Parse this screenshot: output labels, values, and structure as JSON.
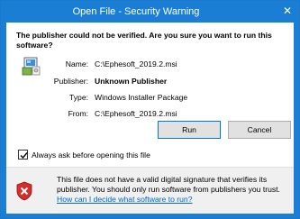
{
  "window": {
    "title": "Open File - Security Warning",
    "close_glyph": "✕"
  },
  "dialog": {
    "question": "The publisher could not be verified.  Are you sure you want to run this software?",
    "icon": "installer-file-icon",
    "details": [
      {
        "label": "Name:",
        "value": "C:\\Ephesoft_2019.2.msi",
        "bold": false
      },
      {
        "label": "Publisher:",
        "value": "Unknown Publisher",
        "bold": true
      },
      {
        "label": "Type:",
        "value": "Windows Installer Package",
        "bold": false
      },
      {
        "label": "From:",
        "value": "C:\\Ephesoft_2019.2.msi",
        "bold": false
      }
    ],
    "buttons": {
      "run": "Run",
      "cancel": "Cancel"
    },
    "checkbox": {
      "label": "Always ask before opening this file",
      "checked": true
    }
  },
  "info": {
    "icon": "shield-error-icon",
    "message": "This file does not have a valid digital signature that verifies its publisher.  You should only run software from publishers you trust.",
    "link": "How can I decide what software to run?"
  },
  "colors": {
    "titlebar": "#1a7fd4",
    "link": "#0066cc",
    "shield_red": "#d62d2d"
  }
}
